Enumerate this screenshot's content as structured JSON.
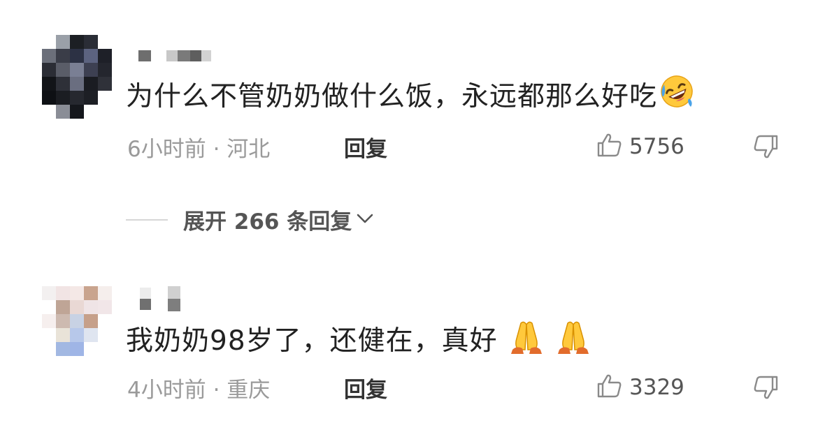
{
  "comments": [
    {
      "text": "为什么不管奶奶做什么饭，永远都那么好吃",
      "emoji": "rolling-on-floor-laughing",
      "time": "6小时前",
      "location": "河北",
      "reply_label": "回复",
      "likes": "5756",
      "expand_replies": "展开 266 条回复"
    },
    {
      "text": "我奶奶98岁了，还健在，真好",
      "emoji": "folded-hands",
      "time": "4小时前",
      "location": "重庆",
      "reply_label": "回复",
      "likes": "3329"
    }
  ],
  "icons": {
    "like": "thumbs-up-icon",
    "dislike": "thumbs-down-icon",
    "expand": "chevron-down-icon"
  },
  "colors": {
    "text_primary": "#222222",
    "text_meta": "#9a9a9a",
    "divider": "#d6d6d6"
  }
}
